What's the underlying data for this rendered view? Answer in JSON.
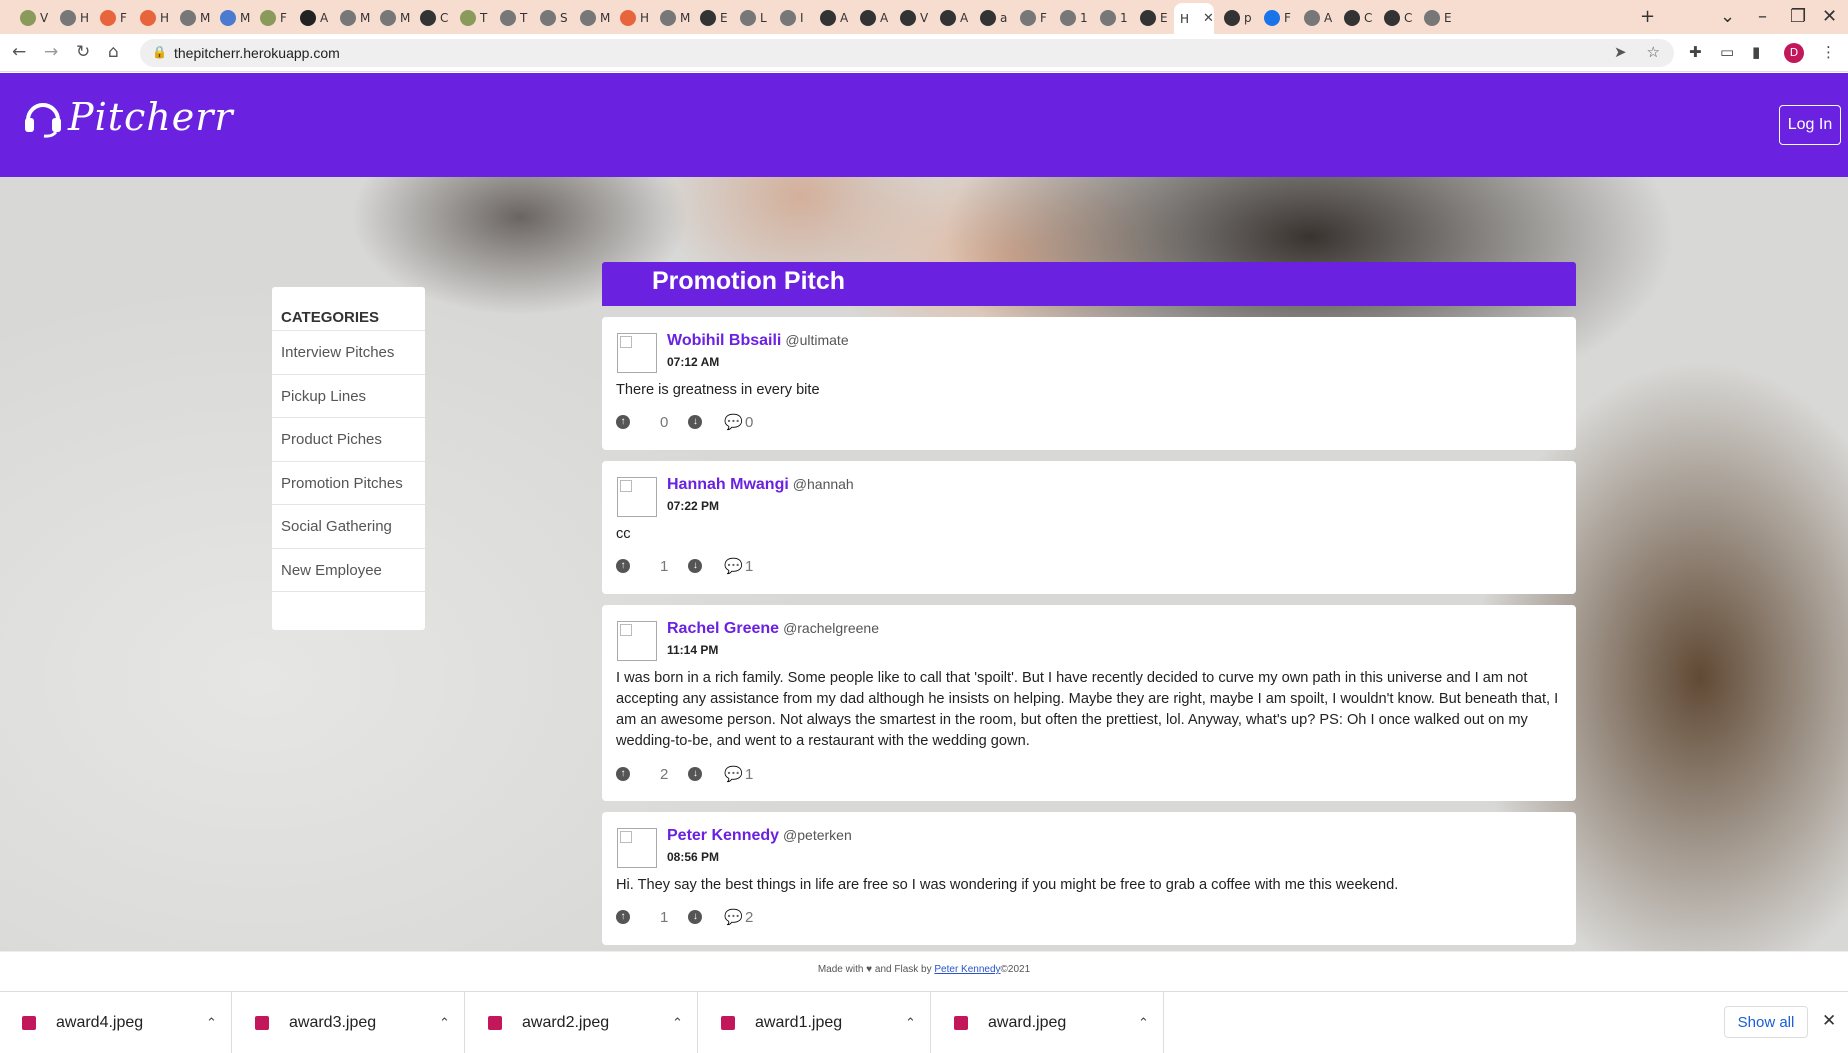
{
  "browser": {
    "url": "thepitcherr.herokuapp.com",
    "active_tab_label": "H",
    "tab_letters": [
      "V",
      "H",
      "F",
      "H",
      "M",
      "M",
      "F",
      "A",
      "M",
      "M",
      "C",
      "T",
      "T",
      "S",
      "M",
      "H",
      "M",
      "E",
      "L",
      "I",
      "A",
      "A",
      "V",
      "A",
      "a",
      "F",
      "1",
      "1",
      "E",
      "p",
      "F",
      "A",
      "C",
      "C",
      "E"
    ],
    "new_tab_label": "+",
    "profile_initial": "D"
  },
  "site": {
    "logo_text": "Pitcherr",
    "login_label": "Log In",
    "brand_color": "#6a22e0"
  },
  "categories": {
    "title": "CATEGORIES",
    "items": [
      "Interview Pitches",
      "Pickup Lines",
      "Product Piches",
      "Promotion Pitches",
      "Social Gathering",
      "New Employee"
    ]
  },
  "main": {
    "title": "Promotion Pitch",
    "pitches": [
      {
        "author": "Wobihil Bbsaili",
        "handle": "@ultimate",
        "time": "07:12 AM",
        "body": "There is greatness in every bite",
        "upvotes": "0",
        "comments": "0"
      },
      {
        "author": "Hannah Mwangi",
        "handle": "@hannah",
        "time": "07:22 PM",
        "body": "cc",
        "upvotes": "1",
        "comments": "1"
      },
      {
        "author": "Rachel Greene",
        "handle": "@rachelgreene",
        "time": "11:14 PM",
        "body": "I was born in a rich family. Some people like to call that 'spoilt'. But I have recently decided to curve my own path in this universe and I am not accepting any assistance from my dad although he insists on helping. Maybe they are right, maybe I am spoilt, I wouldn't know. But beneath that, I am an awesome person. Not always the smartest in the room, but often the prettiest, lol. Anyway, what's up? PS: Oh I once walked out on my wedding-to-be, and went to a restaurant with the wedding gown.",
        "upvotes": "2",
        "comments": "1"
      },
      {
        "author": "Peter Kennedy",
        "handle": "@peterken",
        "time": "08:56 PM",
        "body": "Hi. They say the best things in life are free so I was wondering if you might be free to grab a coffee with me this weekend.",
        "upvotes": "1",
        "comments": "2"
      }
    ]
  },
  "footer": {
    "prefix": "Made with ♥ and Flask by",
    "author_link": "Peter Kennedy",
    "suffix": "©2021"
  },
  "downloads": {
    "files": [
      "award4.jpeg",
      "award3.jpeg",
      "award2.jpeg",
      "award1.jpeg",
      "award.jpeg"
    ],
    "show_all_label": "Show all"
  }
}
